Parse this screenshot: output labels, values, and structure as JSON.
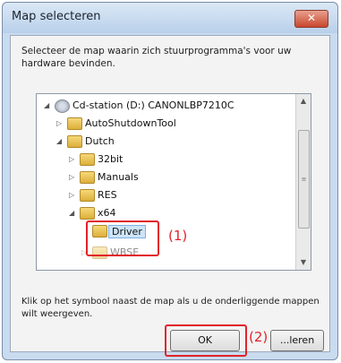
{
  "window": {
    "title": "Map selecteren",
    "close_icon": "close-icon"
  },
  "instruction": "Selecteer de map waarin zich stuurprogramma's voor uw hardware bevinden.",
  "tree": {
    "items": [
      {
        "label": "Cd-station (D:) CANONLBP7210C",
        "icon": "cd-drive-icon"
      },
      {
        "label": "AutoShutdownTool",
        "icon": "folder-icon"
      },
      {
        "label": "Dutch",
        "icon": "folder-icon"
      },
      {
        "label": "32bit",
        "icon": "folder-icon"
      },
      {
        "label": "Manuals",
        "icon": "folder-icon"
      },
      {
        "label": "RES",
        "icon": "folder-icon"
      },
      {
        "label": "x64",
        "icon": "folder-icon"
      },
      {
        "label": "Driver",
        "icon": "folder-icon"
      },
      {
        "label": "WBSE",
        "icon": "folder-icon"
      }
    ]
  },
  "callouts": {
    "one": "(1)",
    "two": "(2)"
  },
  "hint": "Klik op het symbool naast de map als u de onderliggende mappen wilt weergeven.",
  "buttons": {
    "ok": "OK",
    "cancel": "...leren"
  },
  "colors": {
    "callout": "#e1232a",
    "title_bar": "#c9dbef"
  }
}
